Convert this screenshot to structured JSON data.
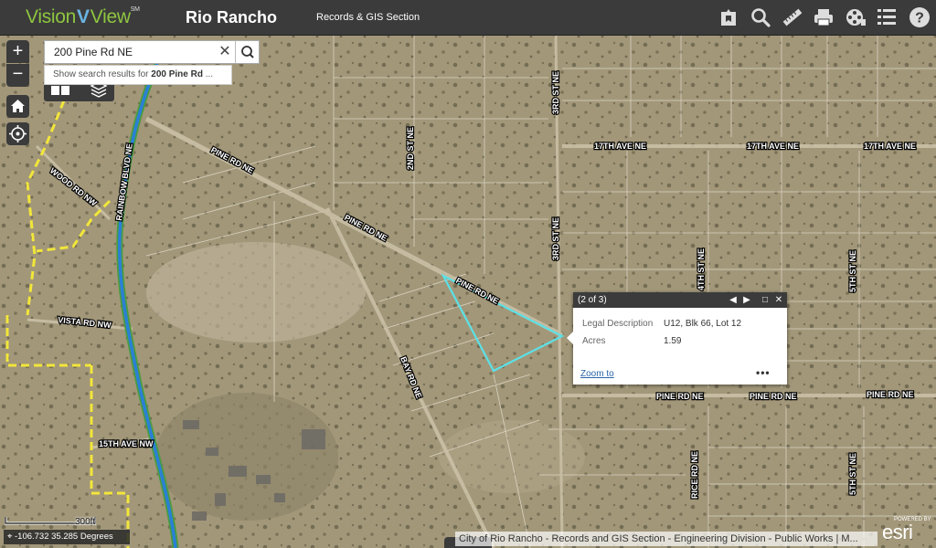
{
  "header": {
    "logo_part1": "Vision",
    "logo_v": "V",
    "logo_part2": "View",
    "logo_sm": "SM",
    "city": "Rio Rancho",
    "section": "Records & GIS Section",
    "icons": [
      "bookmark-icon",
      "search-icon",
      "measure-icon",
      "print-icon",
      "film-reel-icon",
      "list-icon",
      "help-icon"
    ]
  },
  "search": {
    "value": "200 Pine Rd NE",
    "suggestion_prefix": "Show search results for ",
    "suggestion_bold": "200 Pine Rd",
    "suggestion_suffix": " ..."
  },
  "controls": {
    "zoom_in": "+",
    "zoom_out": "−"
  },
  "roads": {
    "pine1": "PINE RD NE",
    "pine2": "PINE RD NE",
    "pine3": "PINE RD NE",
    "pine4": "PINE RD NE",
    "pine5": "PINE RD NE",
    "pine6": "PINE RD NE",
    "wood": "WOOD RD NW",
    "rainbow": "RAINBOW BLVD NE",
    "vista": "VISTA RD NW",
    "fifteenth": "15TH AVE NW",
    "bay": "BAY RD NE",
    "second": "2ND ST NE",
    "third1": "3RD ST NE",
    "third2": "3RD ST NE",
    "seventeenth1": "17TH AVE NE",
    "seventeenth2": "17TH AVE NE",
    "seventeenth3": "17TH AVE NE",
    "fourth": "4TH ST NE",
    "fifth1": "5TH ST NE",
    "fifth2": "5TH ST NE",
    "rice": "RICE RD NE"
  },
  "popup": {
    "title": "(2 of 3)",
    "prev": "◀",
    "next": "▶",
    "maximize": "□",
    "close": "✕",
    "fields": [
      {
        "label": "Legal Description",
        "value": "U12, Blk 66, Lot 12"
      },
      {
        "label": "Acres",
        "value": "1.59"
      }
    ],
    "zoom_to": "Zoom to",
    "more": "•••"
  },
  "footer": {
    "scale": "300ft",
    "coords": "-106.732 35.285 Degrees",
    "attribution": "City of Rio Rancho - Records and GIS Section - Engineering Division - Public Works | M...",
    "powered_by": "POWERED BY",
    "esri": "esri"
  },
  "colors": {
    "header_bg": "#3b3b3b",
    "logo_green": "#8ec63f",
    "parcel_highlight": "#5ce0e6",
    "boundary_yellow": "#f2e63a",
    "river_blue": "#2b7fd6",
    "link_blue": "#2a66a8"
  }
}
